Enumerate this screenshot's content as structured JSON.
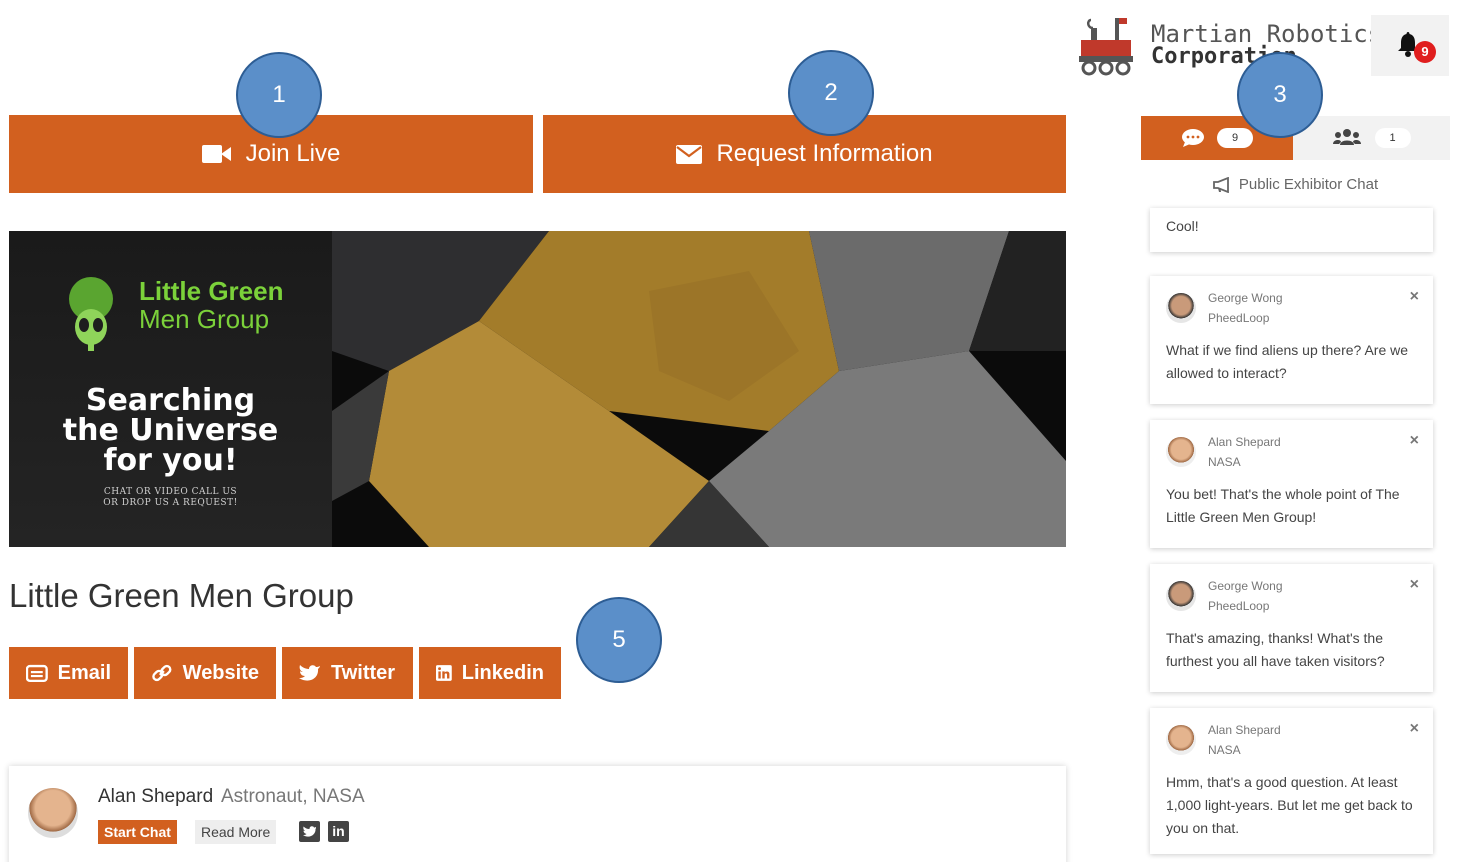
{
  "actions": {
    "join_label": "Join Live",
    "request_label": "Request Information"
  },
  "banner": {
    "logo_title": "Little Green",
    "logo_subtitle": "Men Group",
    "headline_1": "Searching",
    "headline_2": "the Universe",
    "headline_3": "for you!",
    "small_1": "CHAT OR VIDEO CALL US",
    "small_2": "OR DROP US A REQUEST!"
  },
  "company": {
    "title": "Little Green Men Group"
  },
  "social": {
    "email": "Email",
    "website": "Website",
    "twitter": "Twitter",
    "linkedin": "Linkedin"
  },
  "rep": {
    "name": "Alan Shepard",
    "role": "Astronaut, NASA",
    "start_chat": "Start Chat",
    "read_more": "Read More",
    "linkedin_glyph": "in"
  },
  "brand": {
    "line1": "Martian Robotics",
    "line2": "Corporation"
  },
  "notifications": {
    "count": "9"
  },
  "chat_tabs": {
    "chat_count": "9",
    "people_count": "1"
  },
  "public_chat": {
    "label": "Public Exhibitor Chat"
  },
  "messages": [
    {
      "text": "Cool!"
    },
    {
      "name": "George Wong",
      "org": "PheedLoop",
      "text": "What if we find aliens up there? Are we allowed to interact?"
    },
    {
      "name": "Alan Shepard",
      "org": "NASA",
      "text": "You bet! That's the whole point of The Little Green Men Group!"
    },
    {
      "name": "George Wong",
      "org": "PheedLoop",
      "text": "That's amazing, thanks! What's the furthest you all have taken visitors?"
    },
    {
      "name": "Alan Shepard",
      "org": "NASA",
      "text": "Hmm, that's a good question. At least 1,000 light-years. But let me get back to you on that."
    }
  ],
  "close_glyph": "×",
  "callouts": [
    "1",
    "2",
    "3",
    "5"
  ],
  "colors": {
    "accent": "#d2601f",
    "callout": "#5b8fc9",
    "badge": "#e01e1e"
  }
}
